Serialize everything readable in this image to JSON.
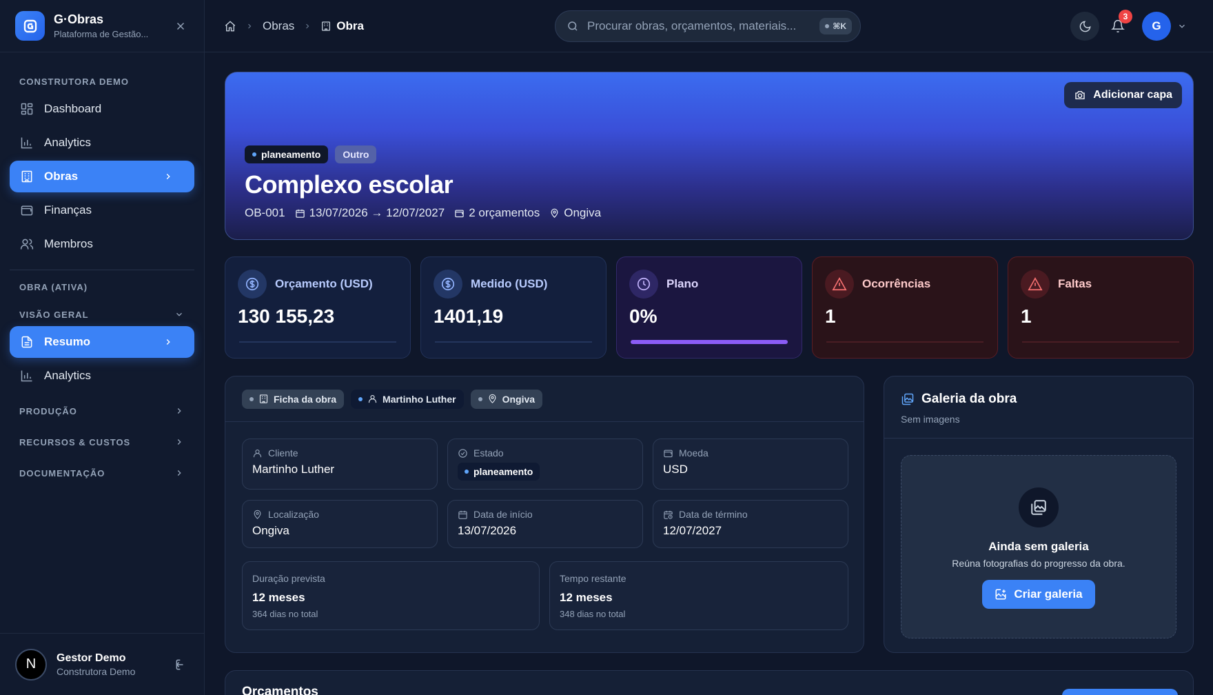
{
  "brand": {
    "name": "G·Obras",
    "subtitle": "Plataforma de Gestão..."
  },
  "sidebar": {
    "org_section": "CONSTRUTORA DEMO",
    "items": [
      {
        "label": "Dashboard",
        "icon": "grid-icon"
      },
      {
        "label": "Analytics",
        "icon": "bar-chart-icon"
      },
      {
        "label": "Obras",
        "icon": "building-icon",
        "active": true
      },
      {
        "label": "Finanças",
        "icon": "wallet-icon"
      },
      {
        "label": "Membros",
        "icon": "users-icon"
      }
    ],
    "work_section": "OBRA (ATIVA)",
    "overview_group": "VISÃO GERAL",
    "work_items": [
      {
        "label": "Resumo",
        "icon": "document-icon",
        "active": true
      },
      {
        "label": "Analytics",
        "icon": "bar-chart-icon"
      }
    ],
    "groups": [
      "PRODUÇÃO",
      "RECURSOS & CUSTOS",
      "DOCUMENTAÇÃO"
    ],
    "user": {
      "initial": "N",
      "name": "Gestor Demo",
      "org": "Construtora Demo"
    }
  },
  "topbar": {
    "breadcrumb": [
      "Obras",
      "Obra"
    ],
    "search_placeholder": "Procurar obras, orçamentos, materiais...",
    "search_shortcut": "⌘K",
    "notifications": "3",
    "avatar": "G"
  },
  "hero": {
    "cover_button": "Adicionar capa",
    "status_tag": "planeamento",
    "type_tag": "Outro",
    "title": "Complexo escolar",
    "code": "OB-001",
    "dates": "13/07/2026 → 12/07/2027",
    "budgets": "2 orçamentos",
    "location": "Ongiva"
  },
  "stats": [
    {
      "label": "Orçamento (USD)",
      "value": "130 155,23"
    },
    {
      "label": "Medido (USD)",
      "value": "1401,19"
    },
    {
      "label": "Plano",
      "value": "0%",
      "progress": 0
    },
    {
      "label": "Ocorrências",
      "value": "1"
    },
    {
      "label": "Faltas",
      "value": "1"
    }
  ],
  "info": {
    "tabs": [
      "Ficha da obra",
      "Martinho Luther",
      "Ongiva"
    ],
    "client_label": "Cliente",
    "client": "Martinho Luther",
    "state_label": "Estado",
    "state": "planeamento",
    "currency_label": "Moeda",
    "currency": "USD",
    "location_label": "Localização",
    "location": "Ongiva",
    "start_label": "Data de início",
    "start": "13/07/2026",
    "end_label": "Data de término",
    "end": "12/07/2027",
    "duration_label": "Duração prevista",
    "duration": "12 meses",
    "duration_sub": "364 dias no total",
    "remaining_label": "Tempo restante",
    "remaining": "12 meses",
    "remaining_sub": "348 dias no total"
  },
  "gallery": {
    "title": "Galeria da obra",
    "subtitle": "Sem imagens",
    "empty_title": "Ainda sem galeria",
    "empty_sub": "Reúna fotografias do progresso da obra.",
    "button": "Criar galeria"
  },
  "budgets_section": {
    "title": "Orçamentos"
  },
  "colors": {
    "accent": "#3b82f6",
    "danger": "#ef4444",
    "plan": "#8b5cf6",
    "background": "#0f172a"
  }
}
